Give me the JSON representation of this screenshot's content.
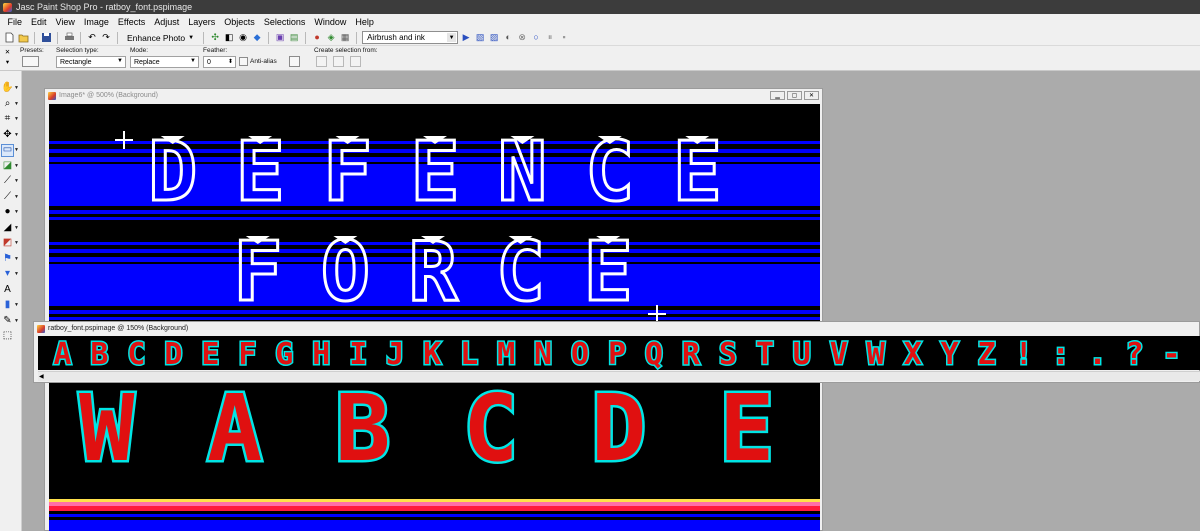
{
  "app": {
    "title": "Jasc Paint Shop Pro - ratboy_font.pspimage"
  },
  "menu": [
    "File",
    "Edit",
    "View",
    "Image",
    "Effects",
    "Adjust",
    "Layers",
    "Objects",
    "Selections",
    "Window",
    "Help"
  ],
  "toolbar": {
    "enhance_label": "Enhance Photo",
    "script_select": "Airbrush and ink"
  },
  "tool_options": {
    "presets_label": "Presets:",
    "selection_type_label": "Selection type:",
    "selection_type_value": "Rectangle",
    "mode_label": "Mode:",
    "mode_value": "Replace",
    "feather_label": "Feather:",
    "feather_value": "0",
    "antialias_label": "Anti-alias",
    "antialias_checked": false,
    "create_selection_label": "Create selection from:"
  },
  "toolbox": [
    {
      "name": "pan-tool",
      "icon": "hand-icon"
    },
    {
      "name": "zoom-tool",
      "icon": "magnifier-icon"
    },
    {
      "name": "crop-tool",
      "icon": "crop-icon"
    },
    {
      "name": "move-tool",
      "icon": "move-icon"
    },
    {
      "name": "selection-tool",
      "icon": "rectangle-select-icon",
      "selected": true
    },
    {
      "name": "dropper-tool",
      "icon": "dropper-icon"
    },
    {
      "name": "paint-brush-tool",
      "icon": "brush-icon"
    },
    {
      "name": "clone-brush-tool",
      "icon": "clone-icon"
    },
    {
      "name": "dodge-tool",
      "icon": "dodge-icon"
    },
    {
      "name": "eraser-tool",
      "icon": "eraser-icon"
    },
    {
      "name": "flood-fill-tool",
      "icon": "paint-bucket-icon"
    },
    {
      "name": "picture-tube-tool",
      "icon": "tube-icon"
    },
    {
      "name": "airbrush-tool",
      "icon": "airbrush-icon"
    },
    {
      "name": "text-tool",
      "icon": "text-icon"
    },
    {
      "name": "preset-shape-tool",
      "icon": "shape-icon"
    },
    {
      "name": "pen-tool",
      "icon": "pen-icon"
    },
    {
      "name": "object-selector-tool",
      "icon": "object-selector-icon"
    }
  ],
  "windows": {
    "image6": {
      "title": "Image6* @ 500% (Background)",
      "art_text": [
        "DEFENCE",
        "FORCE"
      ],
      "art_text_bottom": "WABCDE"
    },
    "ratboy": {
      "title": "ratboy_font.pspimage @ 150% (Background)",
      "font_strip": "ABCDEFGHIJKLMNOPQRSTUVWXYZ!:.?-"
    }
  },
  "colors": {
    "canvas_bg": "#000000",
    "stripe_blue": "#0000ff",
    "art_white": "#ffffff",
    "font_red": "#e01010",
    "font_cyan": "#00e5e5",
    "workspace": "#ababab"
  }
}
